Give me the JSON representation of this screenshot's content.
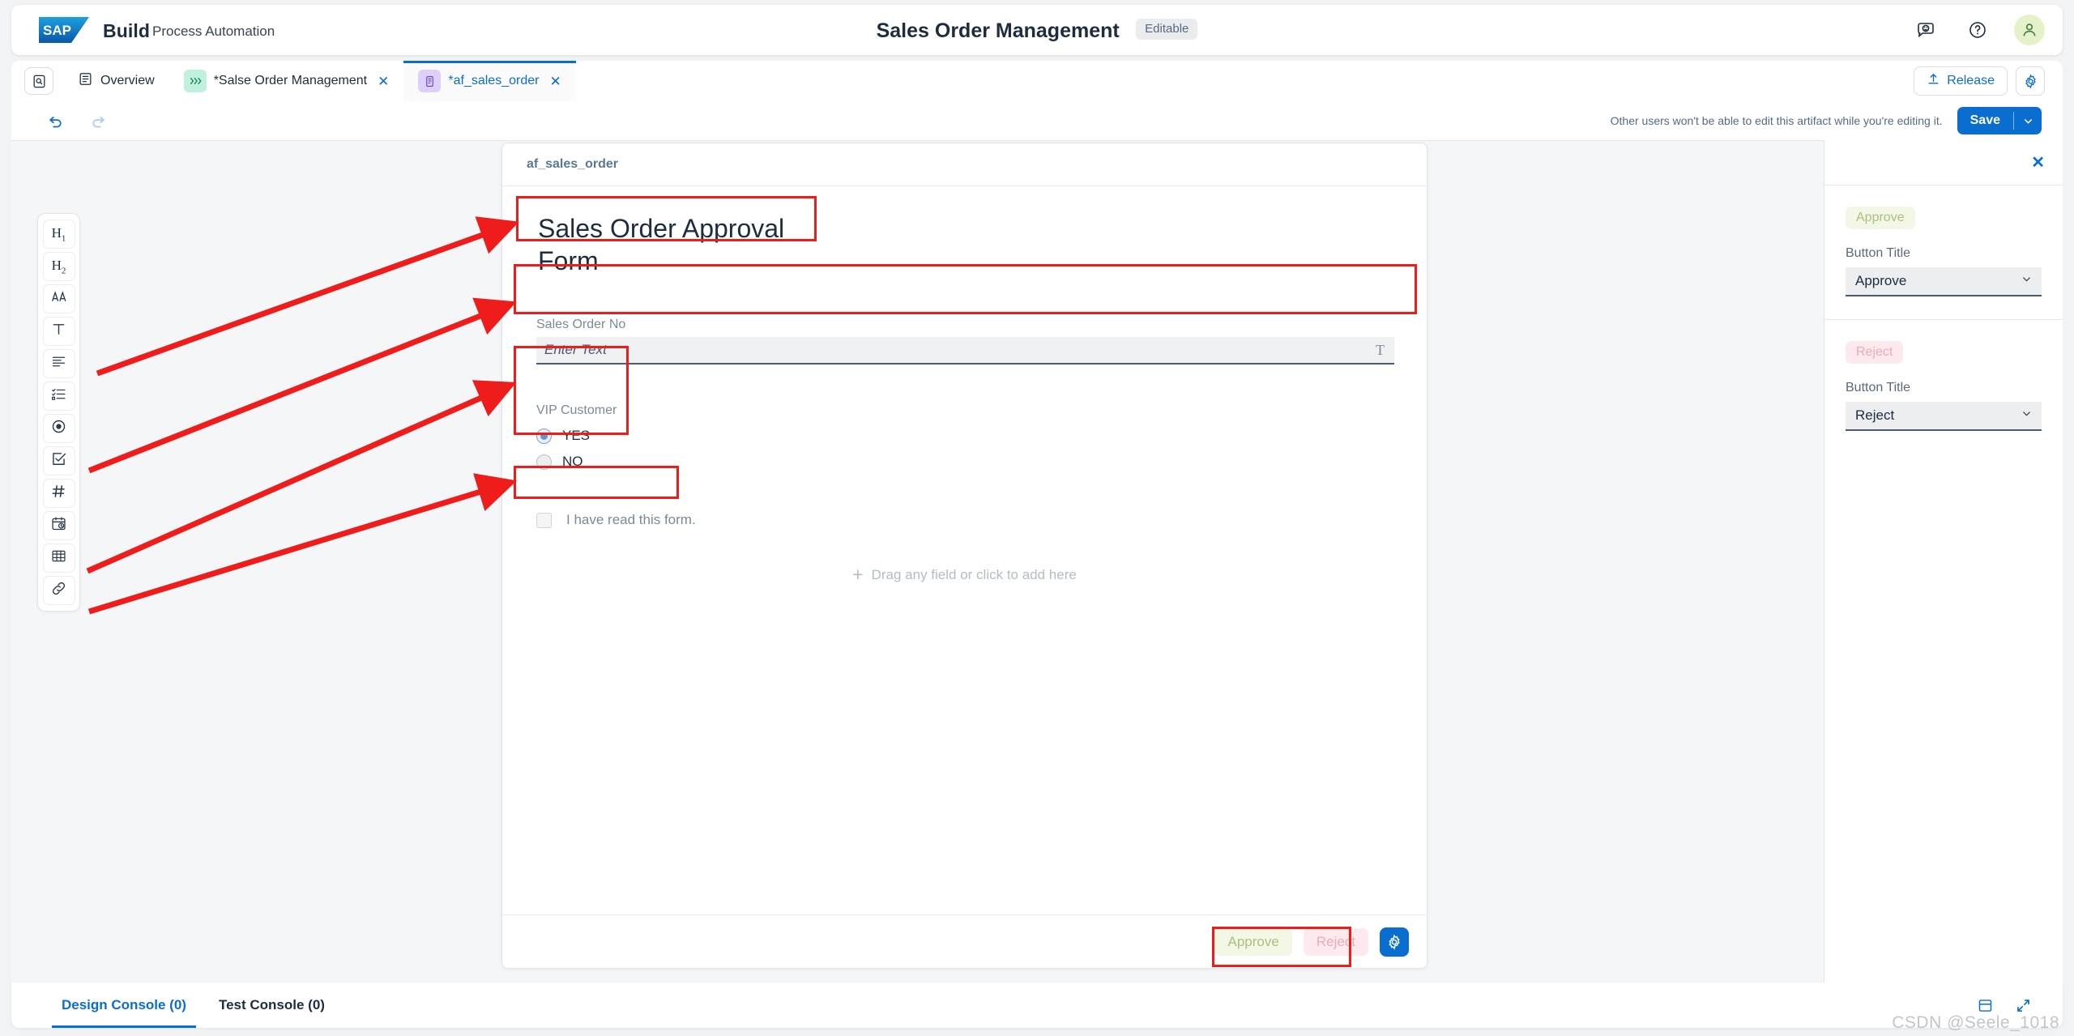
{
  "shell": {
    "logo_text": "SAP",
    "brand": "Build",
    "brand_sub": "Process Automation",
    "title": "Sales Order Management",
    "status_badge": "Editable",
    "icons": {
      "feedback": "feedback-smiley-icon",
      "help": "question-mark-icon",
      "avatar": "user-avatar-icon"
    }
  },
  "tabbar": {
    "home_icon": "search-document-icon",
    "tabs": [
      {
        "label": "Overview",
        "icon": "overview-list-icon",
        "active": false,
        "closable": false,
        "chip": "none"
      },
      {
        "label": "*Salse Order Management",
        "icon": "process-chevrons-icon",
        "active": false,
        "closable": true,
        "chip": "process"
      },
      {
        "label": "*af_sales_order",
        "icon": "form-artifact-icon",
        "active": true,
        "closable": true,
        "chip": "form"
      }
    ],
    "release_label": "Release",
    "release_icon": "upload-arrow-icon",
    "settings_icon": "gear-icon"
  },
  "toolbar": {
    "undo_icon": "undo-arrow-icon",
    "redo_icon": "redo-arrow-icon",
    "lock_note": "Other users won't be able to edit this artifact while you're editing it.",
    "save_label": "Save",
    "save_caret_icon": "chevron-down-icon"
  },
  "palette": {
    "items": [
      {
        "name": "heading-1",
        "glyph": "H",
        "sub": "1"
      },
      {
        "name": "heading-2",
        "glyph": "H",
        "sub": "2"
      },
      {
        "name": "rich-text",
        "glyph": "AA",
        "sub": ""
      },
      {
        "name": "text-field",
        "glyph": "T",
        "sub": ""
      },
      {
        "name": "paragraph",
        "glyph": "",
        "sub": ""
      },
      {
        "name": "list",
        "glyph": "",
        "sub": ""
      },
      {
        "name": "radio-button",
        "glyph": "",
        "sub": ""
      },
      {
        "name": "checkbox",
        "glyph": "",
        "sub": ""
      },
      {
        "name": "number",
        "glyph": "#",
        "sub": ""
      },
      {
        "name": "date-time",
        "glyph": "",
        "sub": ""
      },
      {
        "name": "table",
        "glyph": "",
        "sub": ""
      },
      {
        "name": "link",
        "glyph": "",
        "sub": ""
      }
    ]
  },
  "form": {
    "card_title": "af_sales_order",
    "heading": "Sales Order Approval Form",
    "text_field": {
      "label": "Sales Order No",
      "placeholder": "Enter Text",
      "type_marker": "T"
    },
    "radio_group": {
      "label": "VIP Customer",
      "options": [
        {
          "label": "YES",
          "selected": true
        },
        {
          "label": "NO",
          "selected": false
        }
      ]
    },
    "checkbox": {
      "label": "I have read this form.",
      "checked": false
    },
    "drop_hint": "Drag any field or click to add here",
    "drop_hint_icon": "plus-icon",
    "footer": {
      "approve_label": "Approve",
      "reject_label": "Reject",
      "settings_icon": "gear-icon"
    }
  },
  "properties": {
    "close_icon": "close-x-icon",
    "sections": [
      {
        "chip": "Approve",
        "chip_kind": "approve",
        "label": "Button Title",
        "value": "Approve",
        "caret_icon": "chevron-down-icon"
      },
      {
        "chip": "Reject",
        "chip_kind": "reject",
        "label": "Button Title",
        "value": "Reject",
        "caret_icon": "chevron-down-icon"
      }
    ]
  },
  "console": {
    "tabs": [
      {
        "label": "Design Console (0)",
        "active": true
      },
      {
        "label": "Test Console (0)",
        "active": false
      }
    ],
    "icons": {
      "panel": "split-panel-icon",
      "expand": "fullscreen-expand-icon"
    }
  },
  "watermark": "CSDN @Seele_1018",
  "colors": {
    "accent_blue": "#0a6ed1",
    "annotation_red": "#ef1c1c",
    "approve_bg": "#f3f7e6",
    "approve_fg": "#a9c07e",
    "reject_bg": "#fdeaee",
    "reject_fg": "#eeaab6",
    "canvas_bg": "#f5f6f7",
    "shell_bg": "#f2f3f5"
  }
}
